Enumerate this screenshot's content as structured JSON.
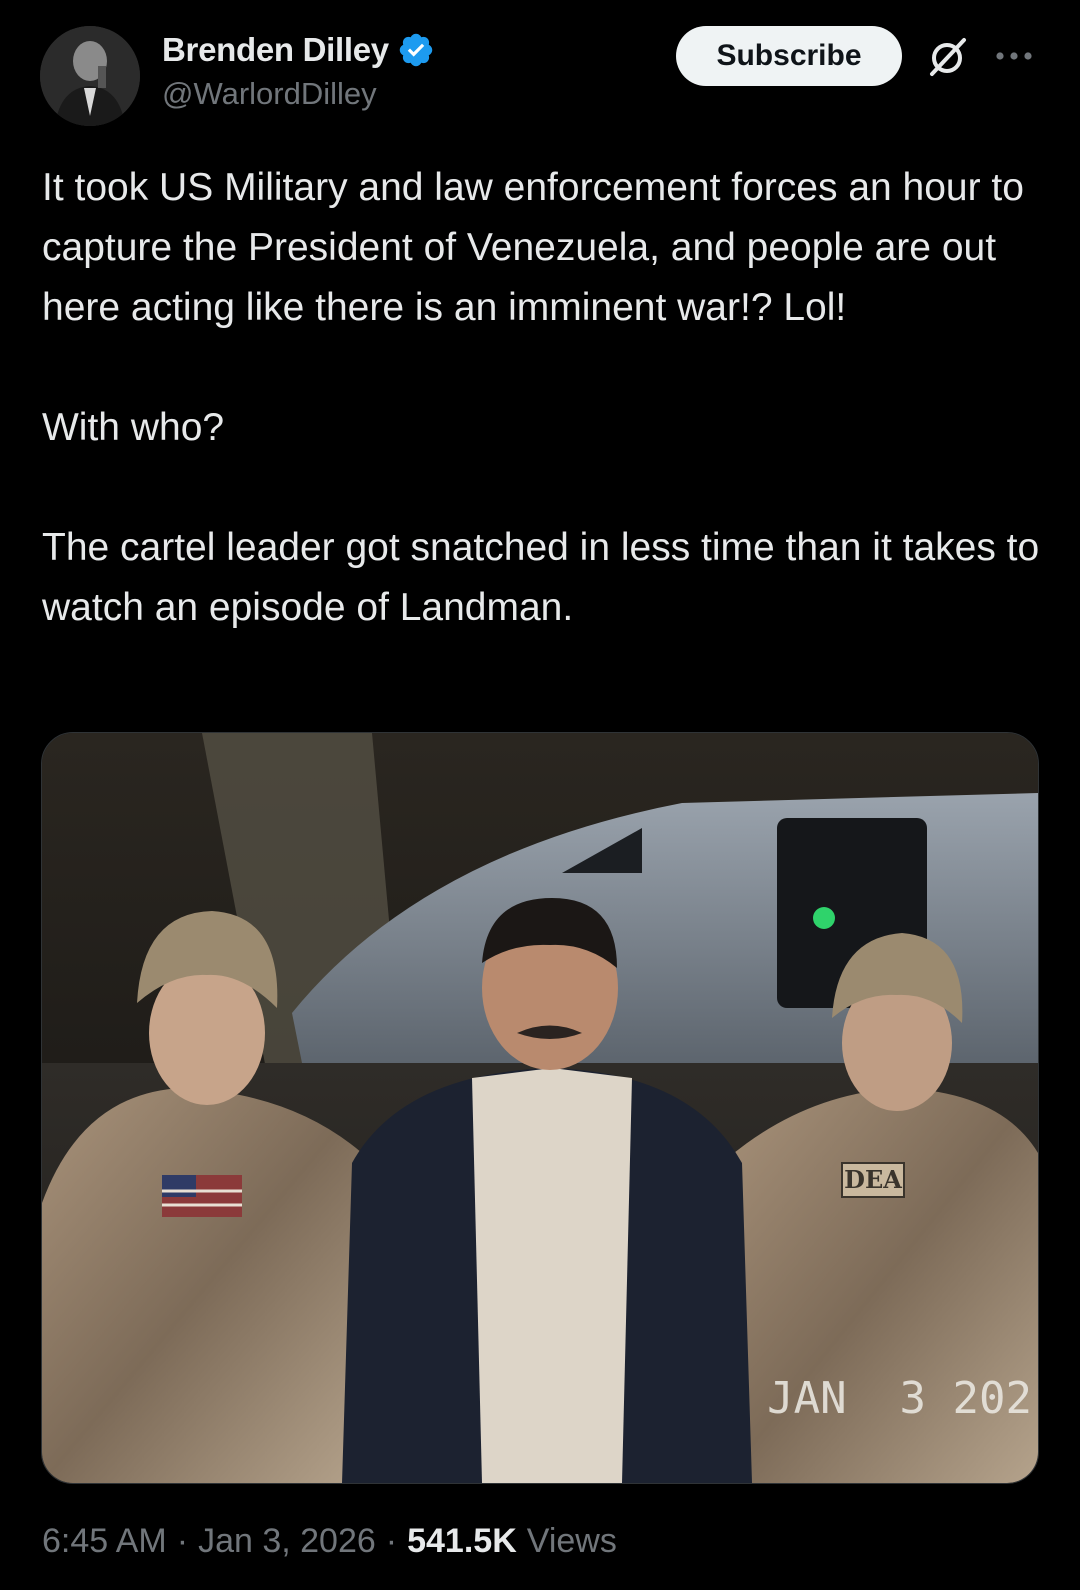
{
  "author": {
    "display_name": "Brenden Dilley",
    "handle": "@WarlordDilley",
    "verified": true,
    "avatar": "avatar-photo"
  },
  "actions": {
    "subscribe_label": "Subscribe",
    "grok_icon": "grok-icon",
    "more_icon": "more-horizontal-icon"
  },
  "tweet": {
    "paragraphs": [
      "It took US Military and law enforcement forces an hour to capture the President of Venezuela, and people are out here acting like there is an imminent war!? Lol!",
      "With who?",
      "The cartel leader got snatched in less time than it takes to watch an episode of Landman."
    ]
  },
  "media": {
    "type": "photo",
    "patch_text": "DEA",
    "date_stamp": "JAN  3 202"
  },
  "meta": {
    "time": "6:45 AM",
    "separator": "·",
    "date": "Jan 3, 2026",
    "views_count": "541.5K",
    "views_label": "Views"
  },
  "colors": {
    "background": "#000000",
    "text_primary": "#e7e9ea",
    "text_secondary": "#71767b",
    "verified_blue": "#1d9bf0",
    "button_bg": "#eff3f4"
  }
}
